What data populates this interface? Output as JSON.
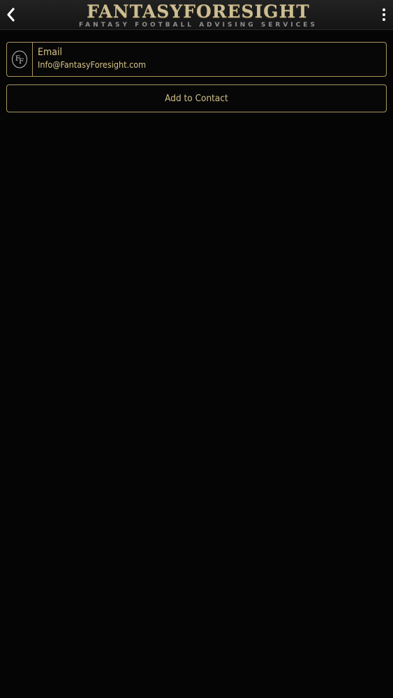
{
  "header": {
    "logo_title": "FANTASYFORESIGHT",
    "logo_subtitle": "FANTASY FOOTBALL ADVISING SERVICES",
    "back_icon": "chevron-left-icon",
    "menu_icon": "overflow-menu-icon"
  },
  "contact_card": {
    "title": "Email",
    "value": "Info@FantasyForesight.com",
    "icon": "ff-logo-icon"
  },
  "actions": {
    "add_contact_label": "Add to Contact"
  },
  "colors": {
    "accent_gold": "#a8955f",
    "text_gold": "#d8c488",
    "background": "#050505"
  }
}
